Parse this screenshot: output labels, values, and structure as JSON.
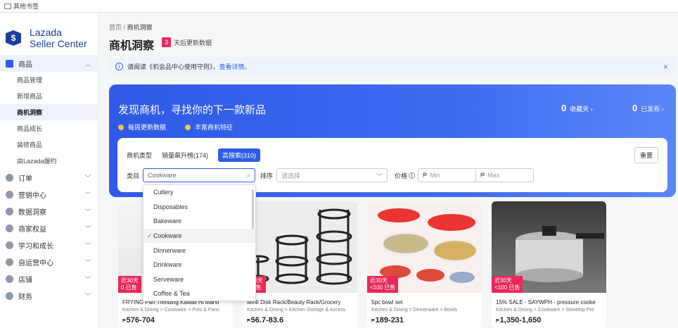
{
  "bookmarks": {
    "label": "其他书签"
  },
  "logo": {
    "line1": "Lazada",
    "line2": "Seller Center",
    "badge": "$"
  },
  "sidebar": {
    "product": {
      "label": "商品",
      "items": [
        "商品管理",
        "新增商品",
        "商机洞察",
        "商品成长",
        "装修商品",
        "由Lazada履约"
      ]
    },
    "sections": [
      "订单",
      "营销中心",
      "数据洞察",
      "商家权益",
      "学习和成长",
      "自运营中心",
      "店铺",
      "财务"
    ]
  },
  "breadcrumb": {
    "home": "首页",
    "sep": "/",
    "current": "商机洞察"
  },
  "page": {
    "title": "商机洞察",
    "countdown": "3",
    "countdown_text": "天后更新数据"
  },
  "notice": {
    "text": "请阅读《机会品中心使用守则》，",
    "link": "查看详情。",
    "close": "×"
  },
  "hero": {
    "title": "发现商机，寻找你的下一款新品",
    "feature1": "每周更新数据",
    "feature2": "丰富商机特征",
    "fav_count": "0",
    "fav_label": "收藏夹 ›",
    "pub_count": "0",
    "pub_label": "已发布 ›"
  },
  "filter": {
    "type_label": "商机类型",
    "tab1": "销量飙升榜(174)",
    "tab2": "高搜索(310)",
    "reset": "重置",
    "category_label": "类目",
    "category_value": "Cookware",
    "sort_label": "排序",
    "sort_placeholder": "请选择",
    "price_label": "价格",
    "min_placeholder": "Min",
    "max_placeholder": "Max",
    "currency": "₱"
  },
  "dropdown": {
    "options": [
      "Cutlery",
      "Disposables",
      "Bakeware",
      "Cookware",
      "Dinnerware",
      "Drinkware",
      "Serveware",
      "Coffee & Tea"
    ],
    "selected_index": 3
  },
  "cards": [
    {
      "tag1": "近30天",
      "tag2": "0 已售",
      "title": "FRYING Pan Trending Kawaii Hi Marvi",
      "cat": "Kitchen & Dining > Cookware > Pots & Pans",
      "price": "576-704"
    },
    {
      "tag1": "近30天",
      "tag2": "0 已售",
      "title": "MINI Disk Rack/Beauty Rack/Grocery",
      "cat": "Kitchen & Dining > Kitchen Storage & Access",
      "price": "56.7-83.6"
    },
    {
      "tag1": "近30天",
      "tag2": "<100 已售",
      "title": "5pc bowl set",
      "cat": "Kitchen & Dining > Dinnerware > Bowls",
      "price": "189-231"
    },
    {
      "tag1": "近30天",
      "tag2": "<100 已售",
      "title": "15% SALE - SAYWPH - pressure cooke",
      "cat": "Kitchen & Dining > Cookware > Stovetop Pre",
      "price": "1,350-1,650"
    }
  ],
  "colors": {
    "accent": "#2f5bea",
    "sale_tag": "#e8285a",
    "brand": "#1a3e9e"
  }
}
